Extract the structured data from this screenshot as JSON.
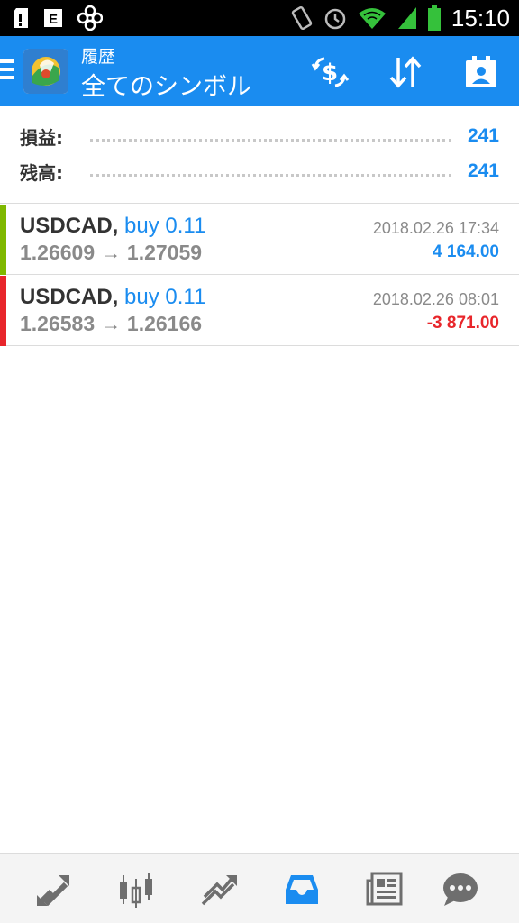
{
  "status_bar": {
    "time": "15:10",
    "left_icons": [
      "sd-card-icon",
      "e-notification-icon",
      "fan-icon"
    ],
    "right_icons": [
      "vibrate-icon",
      "alarm-icon",
      "wifi-icon",
      "signal-icon",
      "battery-icon"
    ]
  },
  "app_bar": {
    "subtitle": "履歴",
    "title": "全てのシンボル",
    "background": "#1a8cf0",
    "actions": [
      "currency-exchange-icon",
      "sort-icon",
      "calendar-user-icon"
    ]
  },
  "summary": [
    {
      "label": "損益:",
      "value": "241"
    },
    {
      "label": "残高:",
      "value": "241"
    }
  ],
  "trades": [
    {
      "symbol": "USDCAD,",
      "type": "buy 0.11",
      "open_price": "1.26609",
      "arrow": "→",
      "close_price": "1.27059",
      "time": "2018.02.26 17:34",
      "profit": "4 164.00",
      "bar_color": "#7fb800",
      "profit_color": "#1a8cf0"
    },
    {
      "symbol": "USDCAD,",
      "type": "buy 0.11",
      "open_price": "1.26583",
      "arrow": "→",
      "close_price": "1.26166",
      "time": "2018.02.26 08:01",
      "profit": "-3 871.00",
      "bar_color": "#e8262b",
      "profit_color": "#e8262b"
    }
  ],
  "bottom_nav": {
    "items": [
      "quotes-icon",
      "chart-icon",
      "trade-icon",
      "history-icon",
      "news-icon",
      "chat-icon"
    ],
    "active": "history-icon",
    "active_color": "#1a8cf0",
    "inactive_color": "#6e6e6e"
  }
}
